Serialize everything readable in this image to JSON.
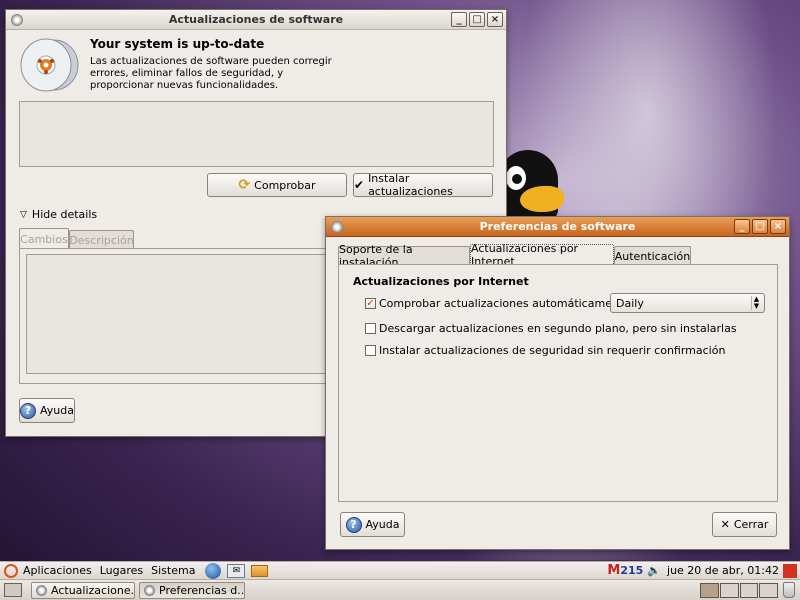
{
  "update_window": {
    "title": "Actualizaciones de software",
    "heading": "Your system is up-to-date",
    "description_lines": [
      "Las actualizaciones de software pueden corregir",
      "errores, eliminar fallos de seguridad, y",
      "proporcionar nuevas funcionalidades."
    ],
    "check_button": "Comprobar",
    "install_button": "Instalar actualizaciones",
    "details_toggle": "Hide details",
    "tabs": [
      "Cambios",
      "Descripción"
    ],
    "help_button": "Ayuda"
  },
  "prefs_window": {
    "title": "Preferencias de software",
    "tabs": [
      "Soporte de la instalación",
      "Actualizaciones por Internet",
      "Autenticación"
    ],
    "section_title": "Actualizaciones por Internet",
    "options": [
      {
        "label": "Comprobar actualizaciones automáticamente:",
        "checked": true
      },
      {
        "label": "Descargar actualizaciones en segundo plano, pero sin instalarlas",
        "checked": false
      },
      {
        "label": "Instalar actualizaciones de seguridad sin requerir confirmación",
        "checked": false
      }
    ],
    "frequency_value": "Daily",
    "help_button": "Ayuda",
    "close_button": "Cerrar"
  },
  "top_panel": {
    "menus": [
      "Aplicaciones",
      "Lugares",
      "Sistema"
    ],
    "mail_count": "215",
    "clock": "jue 20 de abr, 01:42"
  },
  "taskbar": {
    "tasks": [
      "Actualizacione...",
      "Preferencias d..."
    ]
  },
  "colors": {
    "title_active": "#c8641f",
    "window_bg": "#efebe7",
    "check_mark": "#c23b12"
  }
}
